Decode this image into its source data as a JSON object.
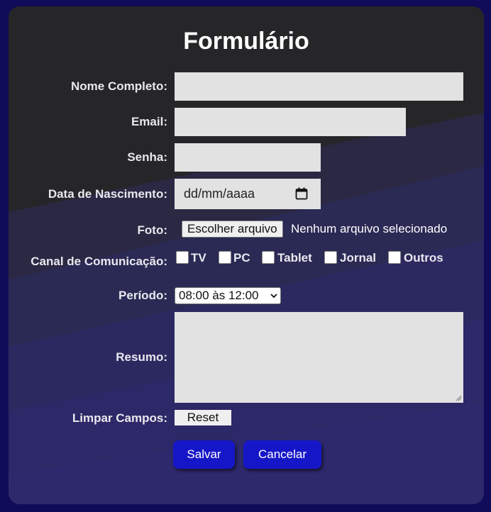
{
  "form": {
    "title": "Formulário",
    "labels": {
      "full_name": "Nome Completo:",
      "email": "Email:",
      "password": "Senha:",
      "birth_date": "Data de Nascimento:",
      "photo": "Foto:",
      "channel": "Canal de Comunicação:",
      "period": "Período:",
      "summary": "Resumo:",
      "clear_fields": "Limpar Campos:"
    },
    "fields": {
      "full_name_value": "",
      "email_value": "",
      "password_value": "",
      "birth_date_placeholder": "dd/mm/aaaa",
      "summary_value": ""
    },
    "file": {
      "button_label": "Escolher arquivo",
      "status": "Nenhum arquivo selecionado"
    },
    "channels": [
      {
        "label": "TV",
        "checked": false
      },
      {
        "label": "PC",
        "checked": false
      },
      {
        "label": "Tablet",
        "checked": false
      },
      {
        "label": "Jornal",
        "checked": false
      },
      {
        "label": "Outros",
        "checked": false
      }
    ],
    "period": {
      "selected": "08:00 às 12:00"
    },
    "reset_label": "Reset",
    "save_label": "Salvar",
    "cancel_label": "Cancelar"
  },
  "colors": {
    "page_background": "#100c5a",
    "card_background": "#262528",
    "button_blue": "#1616c9",
    "input_background": "#e2e2e2"
  },
  "icons": {
    "calendar": "calendar-icon",
    "select_arrow": "chevron-down-icon",
    "resize": "resize-grip-icon"
  }
}
